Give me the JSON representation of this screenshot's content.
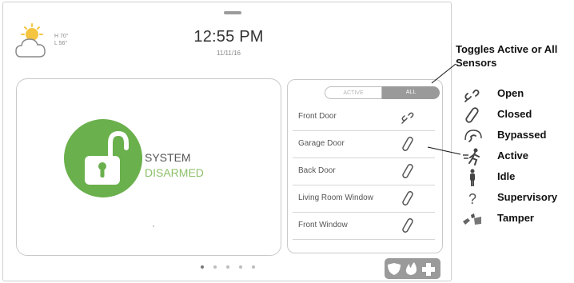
{
  "weather": {
    "high": "H 70°",
    "low": "L 56°",
    "icon": "partly-cloudy-icon"
  },
  "clock": {
    "time": "12:55 PM",
    "date": "11/11/16"
  },
  "system": {
    "status_line1": "SYSTEM",
    "status_line2": "DISARMED",
    "status_icon": "unlocked-padlock-icon",
    "colors": {
      "disarmed": "#6ab04c",
      "disarmed_text": "#8cc06a"
    }
  },
  "sensor_panel": {
    "toggle": {
      "active_label": "ACTIVE",
      "all_label": "ALL",
      "selected": "ALL"
    },
    "sensors": [
      {
        "name": "Front Door",
        "status_icon": "open-icon"
      },
      {
        "name": "Garage Door",
        "status_icon": "closed-icon"
      },
      {
        "name": "Back Door",
        "status_icon": "closed-icon"
      },
      {
        "name": "Living Room Window",
        "status_icon": "closed-icon"
      },
      {
        "name": "Front Window",
        "status_icon": "closed-icon"
      }
    ]
  },
  "pagination": {
    "pages": 5,
    "current": 1
  },
  "action_button": {
    "icons": [
      "shield-icon",
      "flame-icon",
      "plus-icon"
    ]
  },
  "annotations": {
    "toggle_callout": "Toggles Active or All Sensors",
    "legend": [
      {
        "label": "Open",
        "icon": "open-icon"
      },
      {
        "label": "Closed",
        "icon": "closed-icon"
      },
      {
        "label": "Bypassed",
        "icon": "bypassed-icon"
      },
      {
        "label": "Active",
        "icon": "active-motion-icon"
      },
      {
        "label": "Idle",
        "icon": "idle-person-icon"
      },
      {
        "label": "Supervisory",
        "icon": "question-icon"
      },
      {
        "label": "Tamper",
        "icon": "tamper-icon"
      }
    ]
  }
}
